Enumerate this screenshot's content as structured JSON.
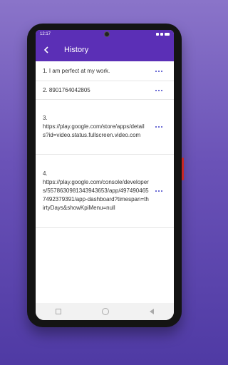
{
  "status": {
    "time": "12:17",
    "extra": "ᵐᵇ̲ ¹⁷"
  },
  "toolbar": {
    "title": "History"
  },
  "items": [
    {
      "text": "1. I am perfect at my work."
    },
    {
      "text": "2. 8901764042805"
    },
    {
      "text": "3.\nhttps://play.google.com/store/apps/details?id=video.status.fullscreen.video.com"
    },
    {
      "text": "4.\nhttps://play.google.com/console/developers/5578630981343943653/app/4974904657492379391/app-dashboard?timespan=thirtyDays&showKpiMenu=null"
    }
  ],
  "icons": {
    "back": "arrow-left-icon",
    "more": "more-horizontal-icon"
  },
  "colors": {
    "accent": "#5b2fb6",
    "dots": "#3d3ec8"
  }
}
